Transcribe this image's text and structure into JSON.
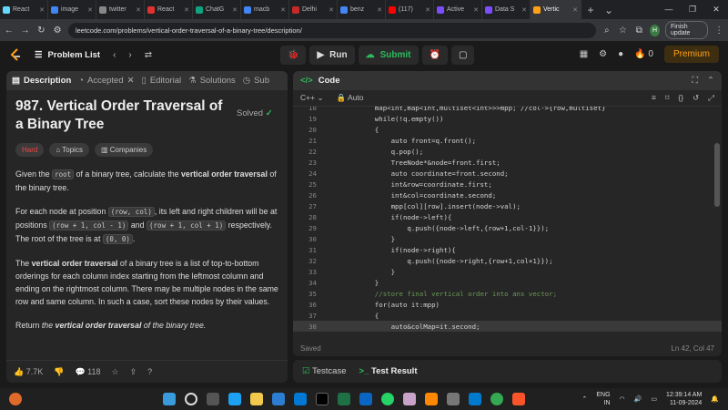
{
  "browser": {
    "tabs": [
      {
        "label": "React",
        "color": "#61dafb"
      },
      {
        "label": "image",
        "color": "#4285f4"
      },
      {
        "label": "twitter",
        "color": "#888888"
      },
      {
        "label": "React",
        "color": "#e03131"
      },
      {
        "label": "ChatG",
        "color": "#10a37f"
      },
      {
        "label": "macb",
        "color": "#4285f4"
      },
      {
        "label": "Delhi",
        "color": "#c62828"
      },
      {
        "label": "benz",
        "color": "#4285f4"
      },
      {
        "label": "(117)",
        "color": "#ff0000"
      },
      {
        "label": "Active",
        "color": "#7c4dff"
      },
      {
        "label": "Data S",
        "color": "#7c4dff"
      },
      {
        "label": "Vertic",
        "color": "#ffa116"
      }
    ],
    "url": "leetcode.com/problems/vertical-order-traversal-of-a-binary-tree/description/",
    "avatar_letter": "H",
    "finish_update": "Finish update"
  },
  "header": {
    "problem_list": "Problem List",
    "run": "Run",
    "submit": "Submit",
    "streak": "0",
    "premium": "Premium"
  },
  "left_tabs": [
    "Description",
    "Accepted",
    "Editorial",
    "Solutions",
    "Sub"
  ],
  "problem": {
    "title": "987. Vertical Order Traversal of a Binary Tree",
    "status": "Solved",
    "difficulty": "Hard",
    "topics": "Topics",
    "companies": "Companies",
    "p1a": "Given the ",
    "p1code": "root",
    "p1b": " of a binary tree, calculate the ",
    "p1bold": "vertical order traversal",
    "p1c": " of the binary tree.",
    "p2a": "For each node at position ",
    "p2code1": "(row, col)",
    "p2b": ", its left and right children will be at positions ",
    "p2code2": "(row + 1, col - 1)",
    "p2c": " and ",
    "p2code3": "(row + 1, col + 1)",
    "p2d": " respectively. The root of the tree is at ",
    "p2code4": "(0, 0)",
    "p2e": ".",
    "p3bold": "vertical order traversal",
    "p3a": "The ",
    "p3b": " of a binary tree is a list of top-to-bottom orderings for each column index starting from the leftmost column and ending on the rightmost column. There may be multiple nodes in the same row and same column. In such a case, sort these nodes by their values.",
    "p4a": "Return ",
    "p4em": "the ",
    "p4bold": "vertical order traversal",
    "p4em2": " of the binary tree."
  },
  "footer": {
    "likes": "7.7K",
    "comments": "118"
  },
  "code_panel": {
    "title": "Code",
    "language": "C++",
    "mode": "Auto",
    "saved": "Saved",
    "cursor": "Ln 42, Col 47"
  },
  "code_lines": [
    {
      "n": "18",
      "t": "    map<int,map<int,multiset<int>>>mpp; //col->{row,multiset}"
    },
    {
      "n": "19",
      "t": "    while(!q.empty())"
    },
    {
      "n": "20",
      "t": "    {"
    },
    {
      "n": "21",
      "t": "        auto front=q.front();"
    },
    {
      "n": "22",
      "t": "        q.pop();"
    },
    {
      "n": "23",
      "t": "        TreeNode*&node=front.first;"
    },
    {
      "n": "24",
      "t": "        auto coordinate=front.second;"
    },
    {
      "n": "25",
      "t": "        int&row=coordinate.first;"
    },
    {
      "n": "26",
      "t": "        int&col=coordinate.second;"
    },
    {
      "n": "27",
      "t": "        mpp[col][row].insert(node->val);"
    },
    {
      "n": "28",
      "t": "        if(node->left){"
    },
    {
      "n": "29",
      "t": "            q.push({node->left,{row+1,col-1}});"
    },
    {
      "n": "30",
      "t": "        }"
    },
    {
      "n": "31",
      "t": "        if(node->right){"
    },
    {
      "n": "32",
      "t": "            q.push({node->right,{row+1,col+1}});"
    },
    {
      "n": "33",
      "t": "        }"
    },
    {
      "n": "34",
      "t": "    }"
    },
    {
      "n": "35",
      "t": "    //store final vertical order into ans vector;"
    },
    {
      "n": "36",
      "t": "    for(auto it:mpp)"
    },
    {
      "n": "37",
      "t": "    {"
    },
    {
      "n": "38",
      "t": "        auto&colMap=it.second;"
    }
  ],
  "bottom_tabs": {
    "testcase": "Testcase",
    "result": "Test Result"
  },
  "taskbar": {
    "lang1": "ENG",
    "lang2": "IN",
    "time": "12:39:14 AM",
    "date": "11-09-2024"
  }
}
